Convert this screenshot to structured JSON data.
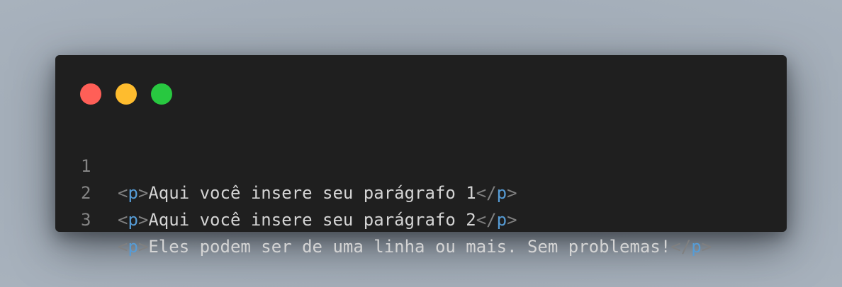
{
  "window": {
    "controls": [
      {
        "name": "close",
        "color": "#ff5f57"
      },
      {
        "name": "minimize",
        "color": "#febc2e"
      },
      {
        "name": "maximize",
        "color": "#28c840"
      }
    ]
  },
  "code": {
    "lines": [
      {
        "number": "1",
        "open_lt": "<",
        "open_tag": "p",
        "open_gt": ">",
        "content": "Aqui você insere seu parágrafo 1",
        "close_lt": "</",
        "close_tag": "p",
        "close_gt": ">"
      },
      {
        "number": "2",
        "open_lt": "<",
        "open_tag": "p",
        "open_gt": ">",
        "content": "Aqui você insere seu parágrafo 2",
        "close_lt": "</",
        "close_tag": "p",
        "close_gt": ">"
      },
      {
        "number": "3",
        "open_lt": "<",
        "open_tag": "p",
        "open_gt": ">",
        "content": "Eles podem ser de uma linha ou mais. Sem problemas!",
        "close_lt": "</",
        "close_tag": "p",
        "close_gt": ">"
      }
    ]
  }
}
